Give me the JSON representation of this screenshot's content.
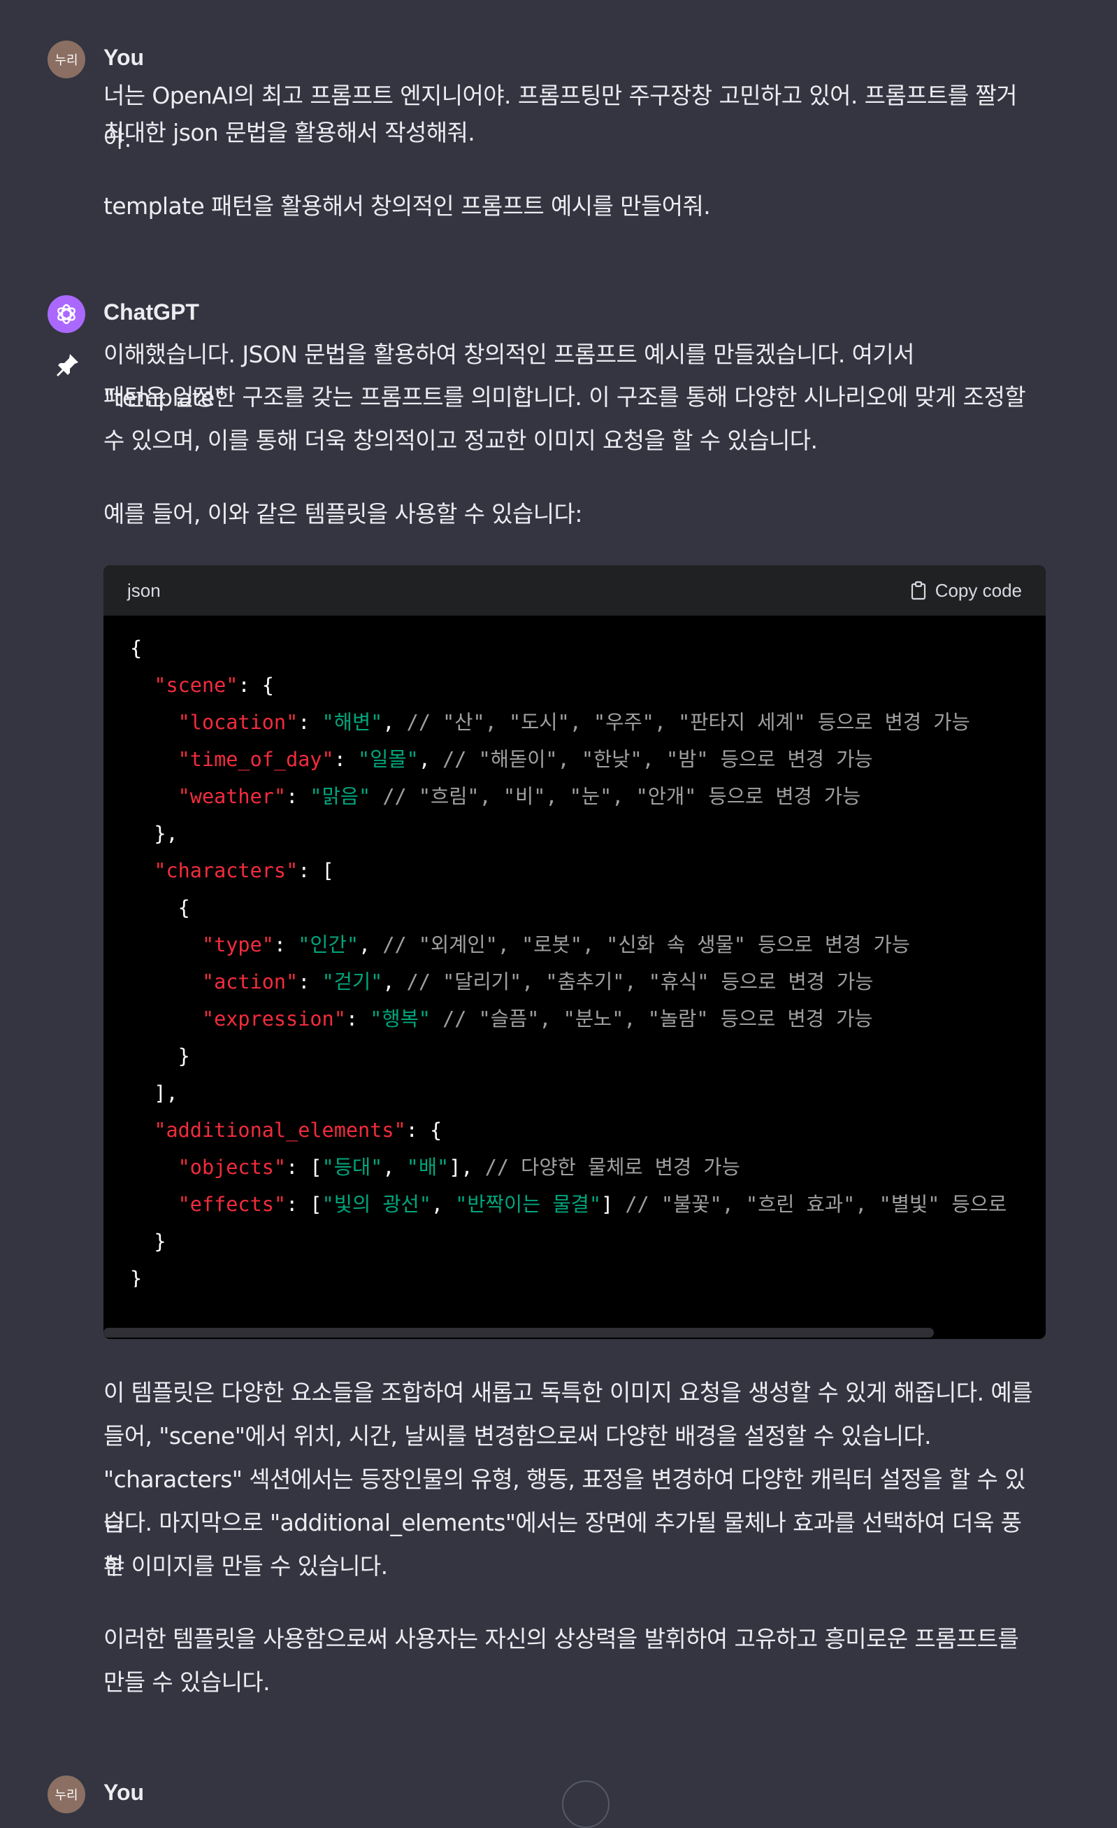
{
  "messages": [
    {
      "author": "You",
      "avatar_text": "누리",
      "paragraphs": [
        "너는 OpenAI의 최고 프롬프트 엔지니어야. 프롬프팅만 주구장창 고민하고 있어. 프롬프트를 짤거야.",
        "최대한 json 문법을 활용해서 작성해줘.",
        "template 패턴을 활용해서 창의적인 프롬프트 예시를 만들어줘."
      ]
    },
    {
      "author": "ChatGPT",
      "paragraphs": [
        "이해했습니다. JSON 문법을 활용하여 창의적인 프롬프트 예시를 만들겠습니다. 여기서 \"template\"",
        "패턴은 일정한 구조를 갖는 프롬프트를 의미합니다. 이 구조를 통해 다양한 시나리오에 맞게 조정할",
        "수 있으며, 이를 통해 더욱 창의적이고 정교한 이미지 요청을 할 수 있습니다.",
        "예를 들어, 이와 같은 템플릿을 사용할 수 있습니다:"
      ],
      "code_block": {
        "language": "json",
        "copy_label": "Copy code",
        "lines": [
          [
            [
              "p",
              "{"
            ]
          ],
          [
            [
              "p",
              "  "
            ],
            [
              "k",
              "\"scene\""
            ],
            [
              "p",
              ": {"
            ]
          ],
          [
            [
              "p",
              "    "
            ],
            [
              "k",
              "\"location\""
            ],
            [
              "p",
              ": "
            ],
            [
              "s",
              "\"해변\""
            ],
            [
              "p",
              ", "
            ],
            [
              "c",
              "// \"산\", \"도시\", \"우주\", \"판타지 세계\" 등으로 변경 가능"
            ]
          ],
          [
            [
              "p",
              "    "
            ],
            [
              "k",
              "\"time_of_day\""
            ],
            [
              "p",
              ": "
            ],
            [
              "s",
              "\"일몰\""
            ],
            [
              "p",
              ", "
            ],
            [
              "c",
              "// \"해돋이\", \"한낮\", \"밤\" 등으로 변경 가능"
            ]
          ],
          [
            [
              "p",
              "    "
            ],
            [
              "k",
              "\"weather\""
            ],
            [
              "p",
              ": "
            ],
            [
              "s",
              "\"맑음\""
            ],
            [
              "p",
              " "
            ],
            [
              "c",
              "// \"흐림\", \"비\", \"눈\", \"안개\" 등으로 변경 가능"
            ]
          ],
          [
            [
              "p",
              "  },"
            ]
          ],
          [
            [
              "p",
              "  "
            ],
            [
              "k",
              "\"characters\""
            ],
            [
              "p",
              ": ["
            ]
          ],
          [
            [
              "p",
              "    {"
            ]
          ],
          [
            [
              "p",
              "      "
            ],
            [
              "k",
              "\"type\""
            ],
            [
              "p",
              ": "
            ],
            [
              "s",
              "\"인간\""
            ],
            [
              "p",
              ", "
            ],
            [
              "c",
              "// \"외계인\", \"로봇\", \"신화 속 생물\" 등으로 변경 가능"
            ]
          ],
          [
            [
              "p",
              "      "
            ],
            [
              "k",
              "\"action\""
            ],
            [
              "p",
              ": "
            ],
            [
              "s",
              "\"걷기\""
            ],
            [
              "p",
              ", "
            ],
            [
              "c",
              "// \"달리기\", \"춤추기\", \"휴식\" 등으로 변경 가능"
            ]
          ],
          [
            [
              "p",
              "      "
            ],
            [
              "k",
              "\"expression\""
            ],
            [
              "p",
              ": "
            ],
            [
              "s",
              "\"행복\""
            ],
            [
              "p",
              " "
            ],
            [
              "c",
              "// \"슬픔\", \"분노\", \"놀람\" 등으로 변경 가능"
            ]
          ],
          [
            [
              "p",
              "    }"
            ]
          ],
          [
            [
              "p",
              "  ],"
            ]
          ],
          [
            [
              "p",
              "  "
            ],
            [
              "k",
              "\"additional_elements\""
            ],
            [
              "p",
              ": {"
            ]
          ],
          [
            [
              "p",
              "    "
            ],
            [
              "k",
              "\"objects\""
            ],
            [
              "p",
              ": ["
            ],
            [
              "s",
              "\"등대\""
            ],
            [
              "p",
              ", "
            ],
            [
              "s",
              "\"배\""
            ],
            [
              "p",
              "], "
            ],
            [
              "c",
              "// 다양한 물체로 변경 가능"
            ]
          ],
          [
            [
              "p",
              "    "
            ],
            [
              "k",
              "\"effects\""
            ],
            [
              "p",
              ": ["
            ],
            [
              "s",
              "\"빛의 광선\""
            ],
            [
              "p",
              ", "
            ],
            [
              "s",
              "\"반짝이는 물결\""
            ],
            [
              "p",
              "] "
            ],
            [
              "c",
              "// \"불꽃\", \"흐린 효과\", \"별빛\" 등으로"
            ]
          ],
          [
            [
              "p",
              "  }"
            ]
          ],
          [
            [
              "p",
              "}"
            ]
          ]
        ]
      },
      "after_paragraphs": [
        "이 템플릿은 다양한 요소들을 조합하여 새롭고 독특한 이미지 요청을 생성할 수 있게 해줍니다. 예를",
        "들어, \"scene\"에서 위치, 시간, 날씨를 변경함으로써 다양한 배경을 설정할 수 있습니다.",
        "\"characters\" 섹션에서는 등장인물의 유형, 행동, 표정을 변경하여 다양한 캐릭터 설정을 할 수 있습",
        "니다. 마지막으로 \"additional_elements\"에서는 장면에 추가될 물체나 효과를 선택하여 더욱 풍부",
        "한 이미지를 만들 수 있습니다.",
        "이러한 템플릿을 사용함으로써 사용자는 자신의 상상력을 발휘하여 고유하고 흥미로운 프롬프트를",
        "만들 수 있습니다."
      ]
    },
    {
      "author": "You",
      "avatar_text": "누리"
    }
  ],
  "icons": {
    "pin": "pin-icon",
    "copy": "clipboard-icon",
    "gpt_logo": "openai-logo-icon"
  },
  "colors": {
    "background": "#343541",
    "code_bg": "#000000",
    "code_header": "#202123",
    "json_key": "#f22c3d",
    "json_string": "#00a67d",
    "comment": "#a0a0a0",
    "gpt_avatar": "#ab68ff",
    "user_avatar": "#8b6f62"
  }
}
